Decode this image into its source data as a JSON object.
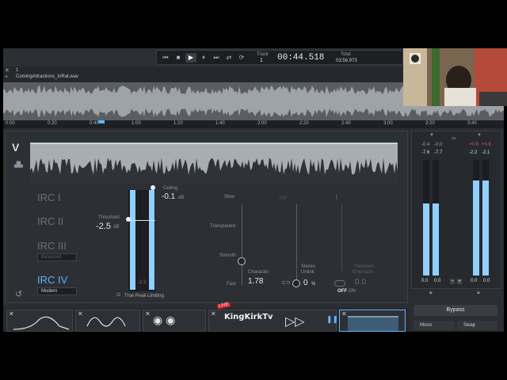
{
  "transport": {
    "buttons": [
      "⏮",
      "■",
      "▶",
      "⏸",
      "⏭",
      "⇄",
      "⟳"
    ],
    "track_label": "Track",
    "track_value": "1",
    "time": "00:44.518",
    "total_label": "Total",
    "total_value": "03:56.973"
  },
  "file": {
    "number": "1",
    "name": "ComingAttractions_InRat.wav",
    "close_icon": "close-icon",
    "add_icon": "plus-icon"
  },
  "timeline": {
    "ticks": [
      "0:00",
      "0:20",
      "0:40",
      "1:00",
      "1:20",
      "1:40",
      "2:00",
      "2:20",
      "2:40",
      "3:00",
      "3:20",
      "3:40"
    ]
  },
  "limiter": {
    "modes": [
      "IRC I",
      "IRC II",
      "IRC III",
      "IRC IV"
    ],
    "irc3_style": "Balanced",
    "irc4_style": "Modern",
    "threshold_label": "Threshold",
    "threshold_value": "-2.5",
    "threshold_unit": "dB",
    "ceiling_label": "Ceiling",
    "ceiling_value": "-0.1",
    "ceiling_unit": "dB",
    "gr_readout": "-2.3",
    "true_peak": "True Peak Limiting",
    "slow_label": "Slow",
    "transparent_label": "Transparent",
    "smooth_label": "Smooth",
    "fast_label": "Fast",
    "character_label": "Character",
    "character_value": "1.78",
    "stereo_label": "Stereo",
    "unlink_label": "Unlink",
    "stereo_value": "0",
    "stereo_unit": "%",
    "transient_label": "Transient",
    "emphasis_label": "Emphasis",
    "transient_value": "0.0",
    "off_label": "OFF",
    "on_label": "ON"
  },
  "meters": {
    "left_top": [
      "-0.4",
      "-0.0"
    ],
    "left_bot": [
      "-7.6",
      "-7.7"
    ],
    "right_top": [
      "+0.9",
      "+0.6"
    ],
    "right_bot": [
      "-2.2",
      "-2.1"
    ],
    "left_foot": [
      "0.0",
      "0.0"
    ],
    "right_foot": [
      "0.0",
      "0.0"
    ],
    "left_fill": [
      0.62,
      0.62
    ],
    "right_fill": [
      0.82,
      0.82
    ]
  },
  "controls": {
    "bypass": "Bypass",
    "mono": "Mono",
    "swap": "Swap"
  },
  "overlay": {
    "live": "LIVE",
    "brand": "KingKirkTv"
  },
  "colors": {
    "accent": "#5fb2ff",
    "meter": "#8fd0ff",
    "clip": "#e0505a"
  }
}
